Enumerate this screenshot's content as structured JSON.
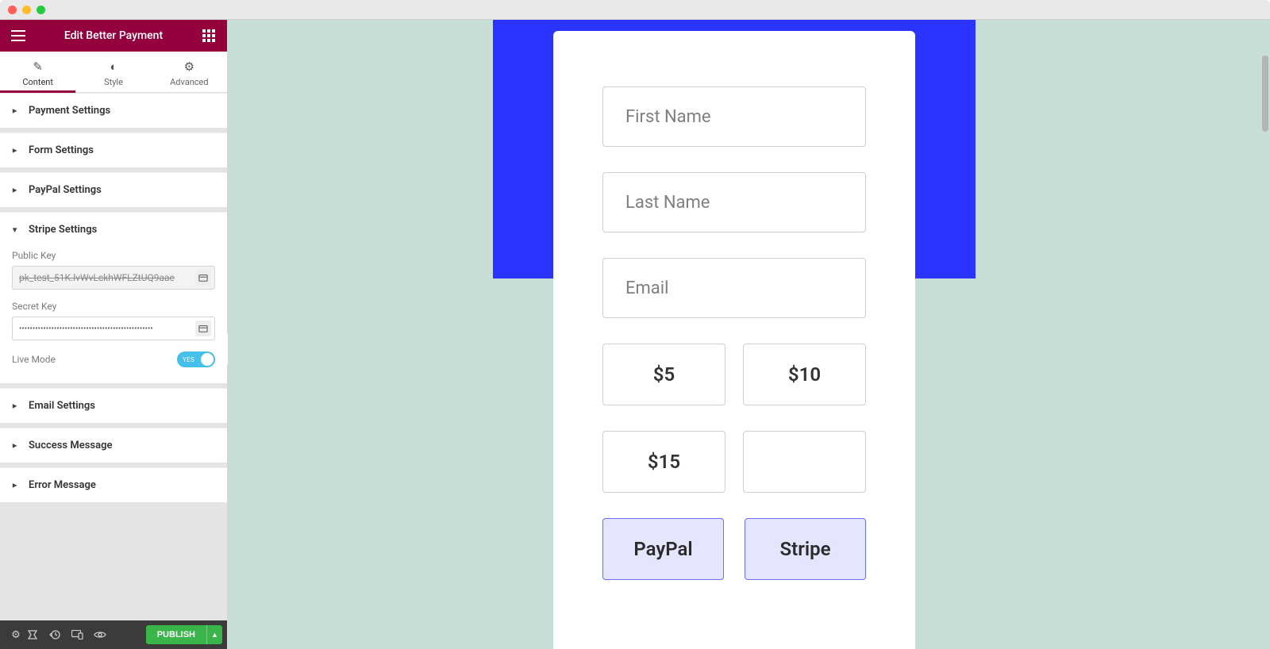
{
  "chrome": {},
  "header": {
    "title": "Edit Better Payment"
  },
  "tabs": [
    {
      "label": "Content",
      "active": true
    },
    {
      "label": "Style",
      "active": false
    },
    {
      "label": "Advanced",
      "active": false
    }
  ],
  "sections": {
    "payment": "Payment Settings",
    "form": "Form Settings",
    "paypal": "PayPal Settings",
    "stripe": "Stripe Settings",
    "email": "Email Settings",
    "success": "Success Message",
    "error": "Error Message"
  },
  "stripe": {
    "public_label": "Public Key",
    "public_value": "pk_test_51K.lvWvLckhWFLZtUQ9aae",
    "secret_label": "Secret Key",
    "secret_value": "••••••••••••••••••••••••••••••••••••••••••••••••••",
    "live_label": "Live Mode",
    "live_on": "YES"
  },
  "footer": {
    "publish": "PUBLISH"
  },
  "preview": {
    "first_name": "First Name",
    "last_name": "Last Name",
    "email": "Email",
    "amounts": [
      "$5",
      "$10",
      "$15",
      ""
    ],
    "pay_buttons": [
      "PayPal",
      "Stripe"
    ]
  }
}
